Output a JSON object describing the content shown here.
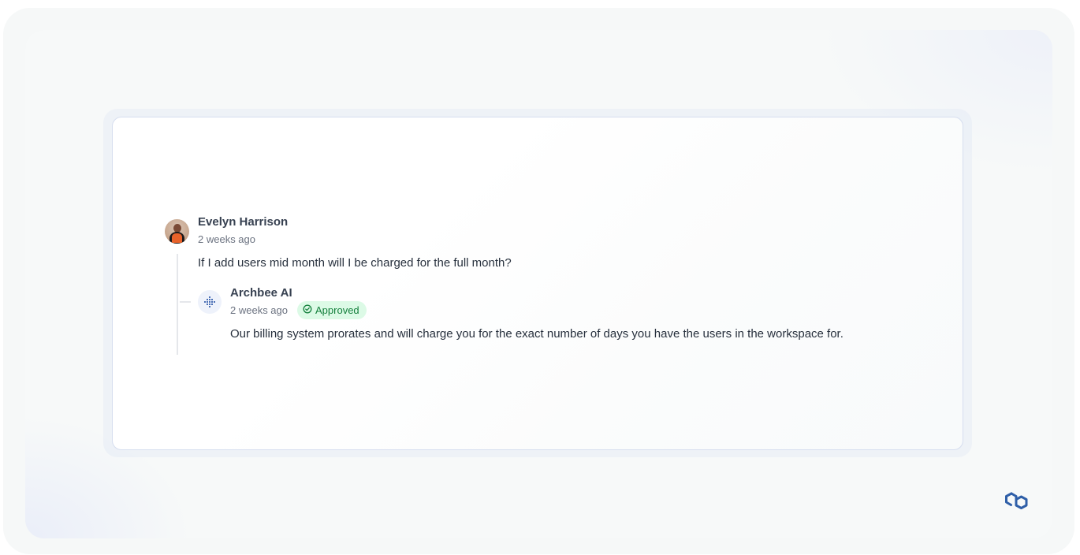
{
  "comment": {
    "author": "Evelyn Harrison",
    "time": "2 weeks ago",
    "text": "If I add users mid month will I be charged for the full month?"
  },
  "reply": {
    "author": "Archbee AI",
    "time": "2 weeks ago",
    "badge": "Approved",
    "text": "Our billing system prorates and will charge you for the exact number of days you have the users in the workspace for."
  },
  "icons": {
    "user_avatar": "user-avatar",
    "ai_avatar": "archbee-ai-icon",
    "badge_icon": "check-circle-icon",
    "logo": "archbee-logo-icon"
  },
  "colors": {
    "badge_bg": "#dcfae6",
    "badge_text": "#15803d",
    "ai_icon": "#4a6fb5",
    "logo": "#2f5fa8"
  }
}
